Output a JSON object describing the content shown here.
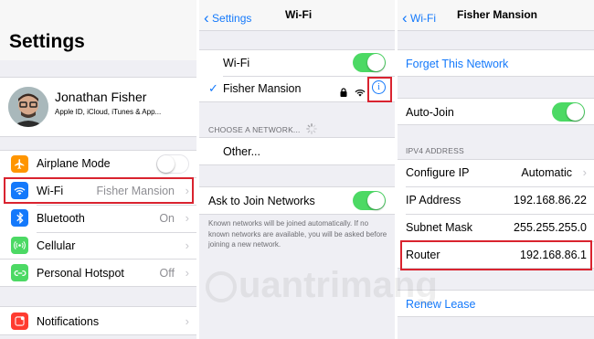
{
  "settings": {
    "title": "Settings",
    "profile": {
      "name": "Jonathan Fisher",
      "subtitle": "Apple ID, iCloud, iTunes & App..."
    },
    "items": [
      {
        "label": "Airplane Mode",
        "value": "",
        "color": "#ff9500",
        "icon": "airplane-icon"
      },
      {
        "label": "Wi-Fi",
        "value": "Fisher Mansion",
        "color": "#1479fb",
        "icon": "wifi-icon"
      },
      {
        "label": "Bluetooth",
        "value": "On",
        "color": "#1479fb",
        "icon": "bluetooth-icon"
      },
      {
        "label": "Cellular",
        "value": "",
        "color": "#4cd964",
        "icon": "cellular-icon"
      },
      {
        "label": "Personal Hotspot",
        "value": "Off",
        "color": "#4cd964",
        "icon": "hotspot-icon"
      },
      {
        "label": "Notifications",
        "value": "",
        "color": "#ff3b30",
        "icon": "notifications-icon"
      }
    ]
  },
  "wifi": {
    "back": "Settings",
    "title": "Wi-Fi",
    "wifi_label": "Wi-Fi",
    "network": "Fisher Mansion",
    "choose_header": "CHOOSE A NETWORK...",
    "other": "Other...",
    "ask_join": "Ask to Join Networks",
    "footer": "Known networks will be joined automatically. If no known networks are available, you will be asked before joining a new network."
  },
  "network": {
    "back": "Wi-Fi",
    "title": "Fisher Mansion",
    "forget": "Forget This Network",
    "auto_join": "Auto-Join",
    "ipv4_header": "IPV4 ADDRESS",
    "configure_ip_label": "Configure IP",
    "configure_ip_value": "Automatic",
    "ip_label": "IP Address",
    "ip_value": "192.168.86.22",
    "subnet_label": "Subnet Mask",
    "subnet_value": "255.255.255.0",
    "router_label": "Router",
    "router_value": "192.168.86.1",
    "renew": "Renew Lease"
  },
  "watermark": "uantrimang",
  "colors": {
    "accent": "#1479fb",
    "toggle_on": "#4cd964",
    "highlight": "#d9232f"
  }
}
